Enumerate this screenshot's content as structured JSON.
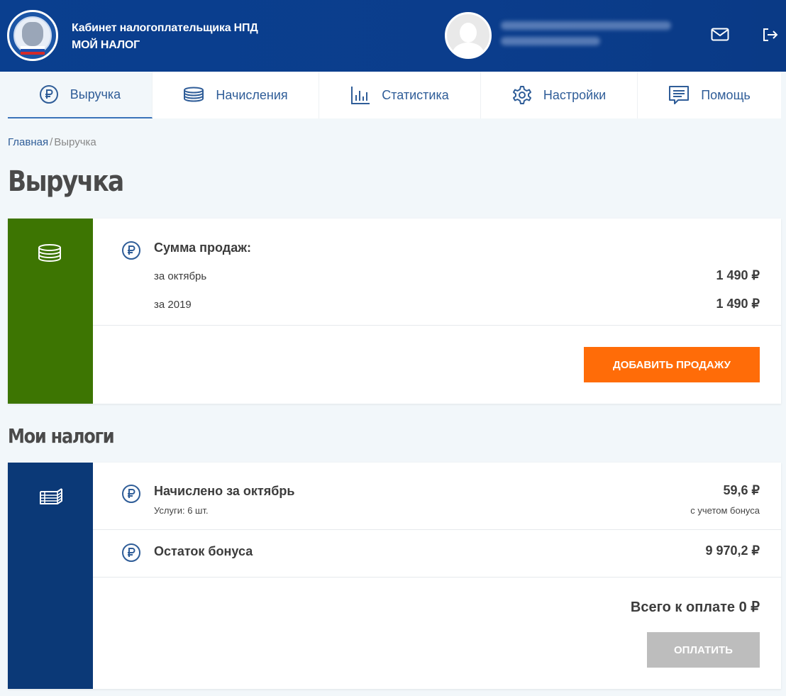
{
  "header": {
    "title_line1": "Кабинет налогоплательщика НПД",
    "title_line2": "МОЙ НАЛОГ"
  },
  "nav": [
    {
      "label": "Выручка",
      "icon": "ruble-circle-icon",
      "active": true
    },
    {
      "label": "Начисления",
      "icon": "coins-stack-icon"
    },
    {
      "label": "Статистика",
      "icon": "bar-chart-icon"
    },
    {
      "label": "Настройки",
      "icon": "gear-icon"
    },
    {
      "label": "Помощь",
      "icon": "help-message-icon"
    }
  ],
  "breadcrumb": {
    "home": "Главная",
    "separator": "/",
    "current": "Выручка"
  },
  "page_title": "Выручка",
  "sales": {
    "heading": "Сумма продаж:",
    "rows": [
      {
        "label": "за октябрь",
        "amount": "1 490 ₽"
      },
      {
        "label": "за 2019",
        "amount": "1 490 ₽"
      }
    ],
    "add_button": "ДОБАВИТЬ ПРОДАЖУ"
  },
  "taxes_title": "Мои налоги",
  "taxes": {
    "accrued_label": "Начислено за октябрь",
    "accrued_sub": "Услуги: 6 шт.",
    "accrued_amount": "59,6 ₽",
    "accrued_note": "с учетом бонуса",
    "bonus_label": "Остаток бонуса",
    "bonus_amount": "9 970,2 ₽",
    "total": "Всего к оплате 0 ₽",
    "pay_button": "ОПЛАТИТЬ"
  },
  "colors": {
    "header": "#0b3d8c",
    "sales_side": "#3d7502",
    "taxes_side": "#0b3977",
    "accent_orange": "#ff6c08",
    "disabled_gray": "#bdbdbd",
    "link": "#2f5d98"
  }
}
